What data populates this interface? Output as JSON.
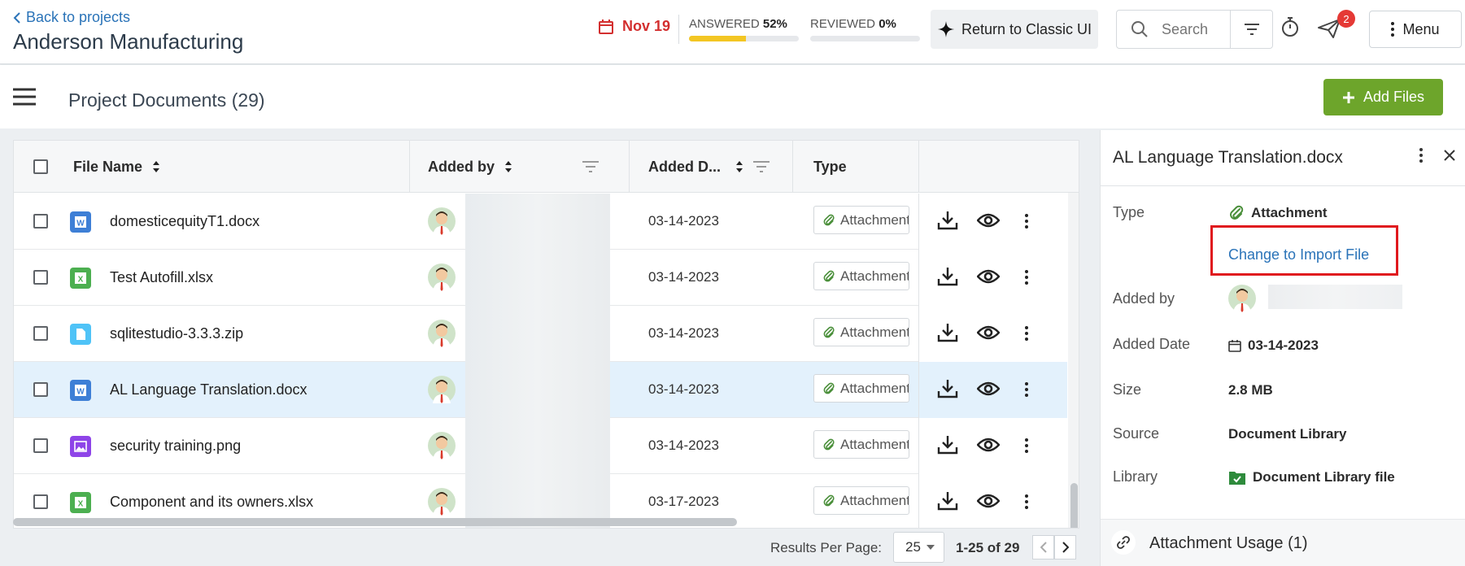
{
  "header": {
    "back_label": "Back to projects",
    "project_title": "Anderson Manufacturing",
    "due_date": "Nov 19",
    "answered_label": "ANSWERED",
    "answered_pct": "52%",
    "answered_value": 0.52,
    "reviewed_label": "REVIEWED",
    "reviewed_pct": "0%",
    "reviewed_value": 0.0,
    "classic_label": "Return to Classic UI",
    "search_placeholder": "Search",
    "notification_count": "2",
    "menu_label": "Menu"
  },
  "section": {
    "title": "Project Documents (29)",
    "add_files_label": "Add Files"
  },
  "table": {
    "columns": {
      "file_name": "File Name",
      "added_by": "Added by",
      "added_date": "Added D...",
      "type": "Type"
    },
    "rows": [
      {
        "name": "domesticequityT1.docx",
        "file_type": "word",
        "date": "03-14-2023",
        "type": "Attachment",
        "selected": false
      },
      {
        "name": "Test Autofill.xlsx",
        "file_type": "excel",
        "date": "03-14-2023",
        "type": "Attachment",
        "selected": false
      },
      {
        "name": "sqlitestudio-3.3.3.zip",
        "file_type": "zip",
        "date": "03-14-2023",
        "type": "Attachment",
        "selected": false
      },
      {
        "name": "AL Language Translation.docx",
        "file_type": "word",
        "date": "03-14-2023",
        "type": "Attachment",
        "selected": true
      },
      {
        "name": "security training.png",
        "file_type": "image",
        "date": "03-14-2023",
        "type": "Attachment",
        "selected": false
      },
      {
        "name": "Component and its owners.xlsx",
        "file_type": "excel",
        "date": "03-17-2023",
        "type": "Attachment",
        "selected": false
      }
    ]
  },
  "footer": {
    "results_per_page_label": "Results Per Page:",
    "results_per_page": "25",
    "range": "1-25 of 29"
  },
  "panel": {
    "title": "AL Language Translation.docx",
    "type_label": "Type",
    "type_value": "Attachment",
    "change_link": "Change to Import File",
    "added_by_label": "Added by",
    "added_date_label": "Added Date",
    "added_date_value": "03-14-2023",
    "size_label": "Size",
    "size_value": "2.8 MB",
    "source_label": "Source",
    "source_value": "Document Library",
    "library_label": "Library",
    "library_value": "Document Library file",
    "usage_label": "Attachment Usage (1)"
  },
  "colors": {
    "accent_link": "#2a73b8",
    "add_button": "#6da52b",
    "progress_fill": "#f3c623",
    "due_red": "#d32f2f",
    "selected_row": "#e3f1fc",
    "highlight_box": "#e0191e"
  }
}
